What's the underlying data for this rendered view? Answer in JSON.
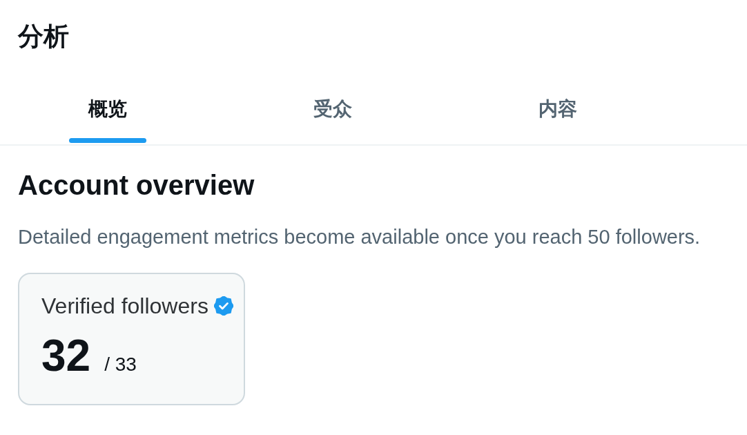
{
  "page": {
    "title": "分析"
  },
  "tabs": [
    {
      "label": "概览",
      "selected": true
    },
    {
      "label": "受众",
      "selected": false
    },
    {
      "label": "内容",
      "selected": false
    }
  ],
  "section": {
    "heading": "Account overview",
    "description": "Detailed engagement metrics become available once you reach 50 followers."
  },
  "stat_card": {
    "label": "Verified followers",
    "value": "32",
    "total": "/ 33"
  }
}
